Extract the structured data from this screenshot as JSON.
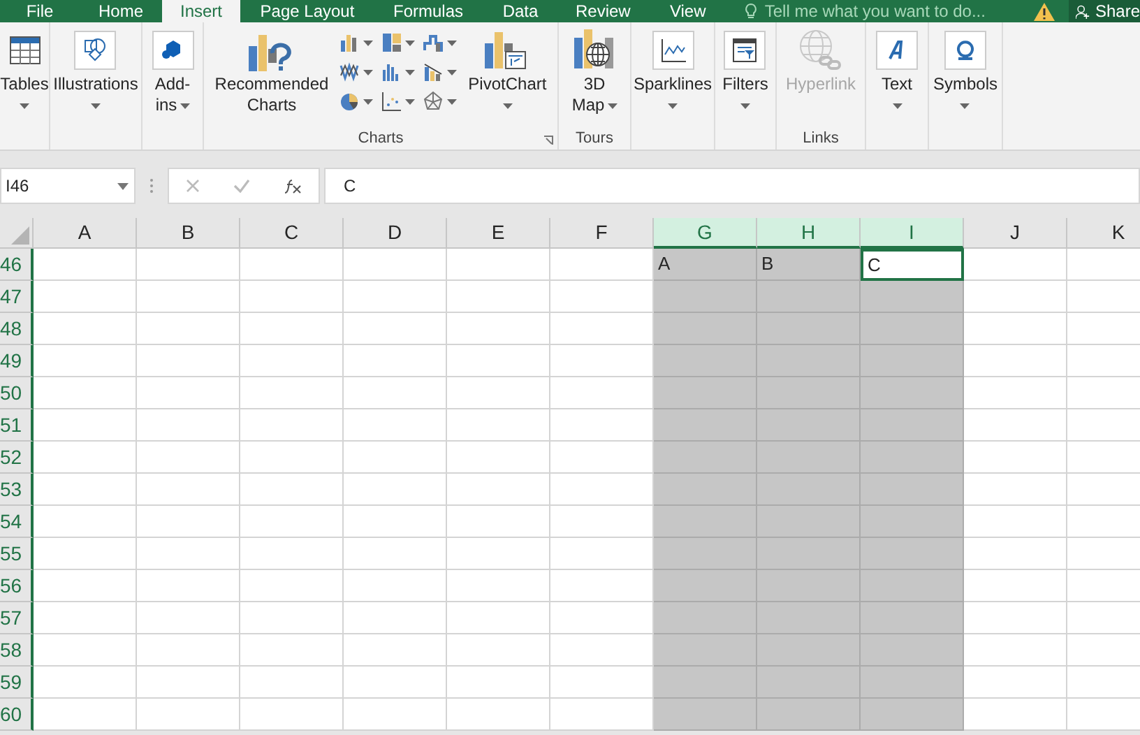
{
  "menu_tabs": [
    {
      "label": "File",
      "selected": false
    },
    {
      "label": "Home",
      "selected": false
    },
    {
      "label": "Insert",
      "selected": true
    },
    {
      "label": "Page Layout",
      "selected": false
    },
    {
      "label": "Formulas",
      "selected": false
    },
    {
      "label": "Data",
      "selected": false
    },
    {
      "label": "Review",
      "selected": false
    },
    {
      "label": "View",
      "selected": false
    }
  ],
  "tell_me": {
    "placeholder": "Tell me what you want to do..."
  },
  "share": {
    "label": "Share"
  },
  "ribbon_groups": [
    {
      "buttons": [
        {
          "kind": "table",
          "lines": [
            "Tables"
          ],
          "dropdown": true,
          "disabled": false
        }
      ]
    },
    {
      "buttons": [
        {
          "kind": "shapes",
          "lines": [
            "Illustrations"
          ],
          "dropdown": true,
          "disabled": false
        }
      ]
    },
    {
      "buttons": [
        {
          "kind": "addin",
          "lines": [
            "Add-",
            "ins"
          ],
          "dropdown": true,
          "disabled": false
        }
      ]
    },
    {
      "label": "Charts",
      "buttons": [
        {
          "kind": "recommended",
          "lines": [
            "Recommended",
            "Charts"
          ],
          "dropdown": false,
          "disabled": false
        },
        {
          "kind": "chart_grid"
        },
        {
          "kind": "pivot",
          "lines": [
            "PivotChart"
          ],
          "dropdown": true,
          "disabled": false
        }
      ]
    },
    {
      "label": "Tours",
      "buttons": [
        {
          "kind": "map",
          "lines": [
            "3D",
            "Map"
          ],
          "dropdown": true,
          "disabled": false
        }
      ]
    },
    {
      "buttons": [
        {
          "kind": "sparkline",
          "lines": [
            "Sparklines"
          ],
          "dropdown": true,
          "disabled": false
        }
      ]
    },
    {
      "buttons": [
        {
          "kind": "filter",
          "lines": [
            "Filters"
          ],
          "dropdown": true,
          "disabled": false
        }
      ]
    },
    {
      "label": "Links",
      "buttons": [
        {
          "kind": "hyperlink",
          "lines": [
            "Hyperlink"
          ],
          "dropdown": false,
          "disabled": true
        }
      ]
    },
    {
      "buttons": [
        {
          "kind": "text",
          "lines": [
            "Text"
          ],
          "dropdown": true,
          "disabled": false
        }
      ]
    },
    {
      "buttons": [
        {
          "kind": "symbol",
          "lines": [
            "Symbols"
          ],
          "dropdown": true,
          "disabled": false
        }
      ]
    }
  ],
  "name_box": {
    "value": "I46"
  },
  "formula_bar": {
    "value": "C"
  },
  "columns": [
    {
      "label": "A",
      "selected": false
    },
    {
      "label": "B",
      "selected": false
    },
    {
      "label": "C",
      "selected": false
    },
    {
      "label": "D",
      "selected": false
    },
    {
      "label": "E",
      "selected": false
    },
    {
      "label": "F",
      "selected": false
    },
    {
      "label": "G",
      "selected": true
    },
    {
      "label": "H",
      "selected": true
    },
    {
      "label": "I",
      "selected": true
    },
    {
      "label": "J",
      "selected": false
    },
    {
      "label": "K",
      "selected": false
    }
  ],
  "rows": [
    {
      "label": "46",
      "cells": [
        {
          "active": false
        },
        {
          "active": false
        },
        {
          "active": false
        },
        {
          "active": false
        },
        {
          "active": false
        },
        {
          "active": false
        },
        {
          "text": "A",
          "active": false
        },
        {
          "text": "B",
          "active": false
        },
        {
          "text": "C",
          "active": true
        },
        {
          "active": false
        },
        {
          "active": false
        }
      ]
    },
    {
      "label": "47"
    },
    {
      "label": "48"
    },
    {
      "label": "49"
    },
    {
      "label": "50"
    },
    {
      "label": "51"
    },
    {
      "label": "52"
    },
    {
      "label": "53"
    },
    {
      "label": "54"
    },
    {
      "label": "55"
    },
    {
      "label": "56"
    },
    {
      "label": "57"
    },
    {
      "label": "58"
    },
    {
      "label": "59"
    },
    {
      "label": "60"
    }
  ]
}
